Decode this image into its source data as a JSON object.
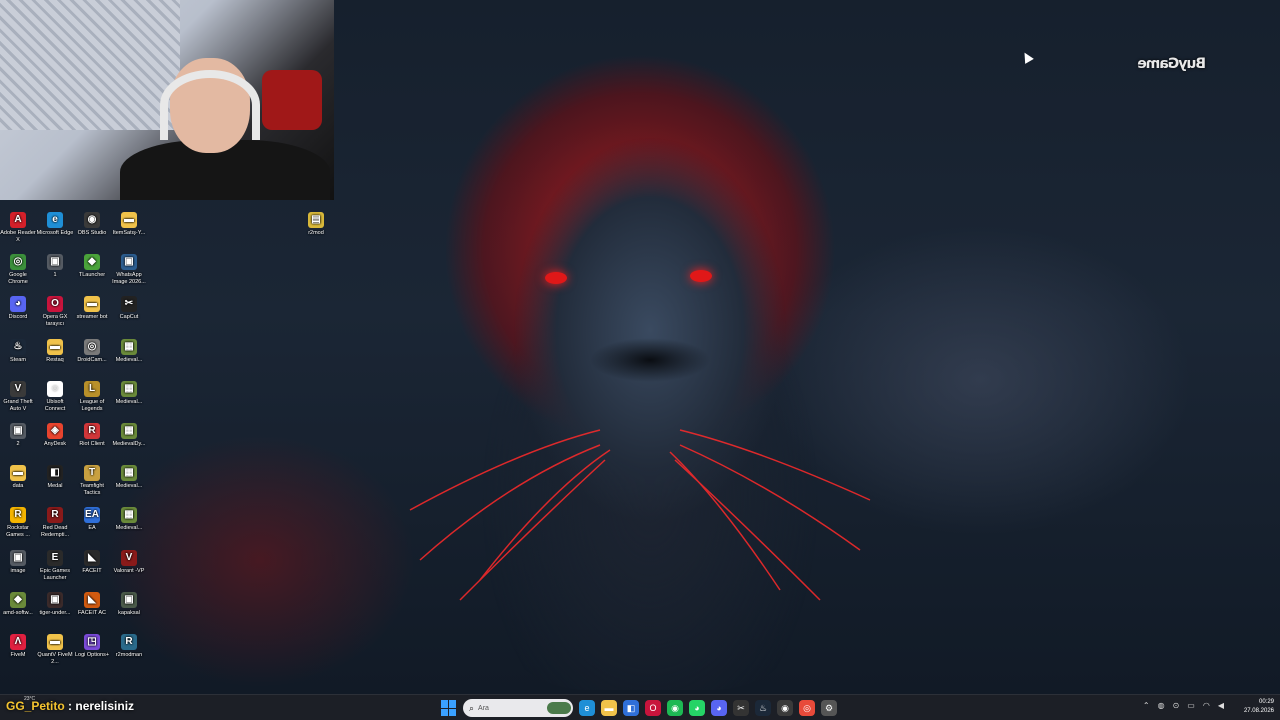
{
  "desktop": {
    "icons": [
      {
        "label": "Adobe Reader X",
        "icon": "adobe-reader-icon",
        "color": "#d4202a",
        "glyph": "A"
      },
      {
        "label": "Microsoft Edge",
        "icon": "edge-icon",
        "color": "#1f8fd6",
        "glyph": "e"
      },
      {
        "label": "OBS Studio",
        "icon": "obs-icon",
        "color": "#3a3a3a",
        "glyph": "◉"
      },
      {
        "label": "ItemSatış-Y...",
        "icon": "folder-icon",
        "color": "#f0c24a",
        "glyph": "▬"
      },
      {
        "label": "Google Chrome",
        "icon": "chrome-icon",
        "color": "#3b8f3b",
        "glyph": "◎"
      },
      {
        "label": "1",
        "icon": "image-file-icon",
        "color": "#555b63",
        "glyph": "▣"
      },
      {
        "label": "TLauncher",
        "icon": "tlauncher-icon",
        "color": "#4aa33a",
        "glyph": "◆"
      },
      {
        "label": "WhatsApp Image 2026...",
        "icon": "image-file-icon",
        "color": "#2c5d8f",
        "glyph": "▣"
      },
      {
        "label": "Discord",
        "icon": "discord-icon",
        "color": "#5865f2",
        "glyph": "◕"
      },
      {
        "label": "Opera GX tarayıcı",
        "icon": "opera-gx-icon",
        "color": "#c8143c",
        "glyph": "O"
      },
      {
        "label": "streamer bot",
        "icon": "folder-icon",
        "color": "#f0c24a",
        "glyph": "▬"
      },
      {
        "label": "CapCut",
        "icon": "capcut-icon",
        "color": "#222",
        "glyph": "✂"
      },
      {
        "label": "Steam",
        "icon": "steam-icon",
        "color": "#1b2838",
        "glyph": "♨"
      },
      {
        "label": "Restaq",
        "icon": "folder-icon",
        "color": "#f0c24a",
        "glyph": "▬"
      },
      {
        "label": "DroidCam...",
        "icon": "droidcam-icon",
        "color": "#7a7a7a",
        "glyph": "◎"
      },
      {
        "label": "Medieval...",
        "icon": "medieval-game-icon",
        "color": "#6a8a3a",
        "glyph": "▦"
      },
      {
        "label": "Grand Theft Auto V",
        "icon": "gta-icon",
        "color": "#3a3a3a",
        "glyph": "V"
      },
      {
        "label": "Ubisoft Connect",
        "icon": "ubisoft-icon",
        "color": "#ffffff",
        "glyph": "◌"
      },
      {
        "label": "League of Legends",
        "icon": "lol-icon",
        "color": "#b8902a",
        "glyph": "L"
      },
      {
        "label": "Medieval...",
        "icon": "medieval-game-icon",
        "color": "#6a8a3a",
        "glyph": "▦"
      },
      {
        "label": "2",
        "icon": "image-file-icon",
        "color": "#555b63",
        "glyph": "▣"
      },
      {
        "label": "AnyDesk",
        "icon": "anydesk-icon",
        "color": "#e8442e",
        "glyph": "◈"
      },
      {
        "label": "Riot Client",
        "icon": "riot-icon",
        "color": "#d13639",
        "glyph": "R"
      },
      {
        "label": "MedievalDy...",
        "icon": "medieval-game-icon",
        "color": "#6a8a3a",
        "glyph": "▦"
      },
      {
        "label": "data",
        "icon": "folder-icon",
        "color": "#f0c24a",
        "glyph": "▬"
      },
      {
        "label": "Medal",
        "icon": "medal-icon",
        "color": "#222",
        "glyph": "◧"
      },
      {
        "label": "Teamfight Tactics",
        "icon": "tft-icon",
        "color": "#c8a040",
        "glyph": "T"
      },
      {
        "label": "Medieval...",
        "icon": "medieval-game-icon",
        "color": "#6a8a3a",
        "glyph": "▦"
      },
      {
        "label": "Rockstar Games ...",
        "icon": "rockstar-icon",
        "color": "#f4b400",
        "glyph": "R"
      },
      {
        "label": "Red Dead Redempti...",
        "icon": "rdr-icon",
        "color": "#8a1a1a",
        "glyph": "R"
      },
      {
        "label": "EA",
        "icon": "ea-icon",
        "color": "#2f6fd8",
        "glyph": "EA"
      },
      {
        "label": "Medieval...",
        "icon": "medieval-game-icon",
        "color": "#6a8a3a",
        "glyph": "▦"
      },
      {
        "label": "image",
        "icon": "image-file-icon",
        "color": "#555b63",
        "glyph": "▣"
      },
      {
        "label": "Epic Games Launcher",
        "icon": "epic-icon",
        "color": "#2a2a2a",
        "glyph": "E"
      },
      {
        "label": "FACEIT",
        "icon": "faceit-icon",
        "color": "#2a2a2a",
        "glyph": "◣"
      },
      {
        "label": "Valorant -VP",
        "icon": "valorant-icon",
        "color": "#8a1a1a",
        "glyph": "V"
      },
      {
        "label": "amd-softw...",
        "icon": "installer-icon",
        "color": "#6a8a3a",
        "glyph": "◆"
      },
      {
        "label": "tiger-under...",
        "icon": "image-file-icon",
        "color": "#3a2a2a",
        "glyph": "▣"
      },
      {
        "label": "FACEIT AC",
        "icon": "faceit-ac-icon",
        "color": "#d05a10",
        "glyph": "◣"
      },
      {
        "label": "kapaksal",
        "icon": "image-file-icon",
        "color": "#4a5a4a",
        "glyph": "▣"
      },
      {
        "label": "FiveM",
        "icon": "fivem-icon",
        "color": "#e02040",
        "glyph": "Λ"
      },
      {
        "label": "QuantV FiveM 2...",
        "icon": "folder-icon",
        "color": "#f0c24a",
        "glyph": "▬"
      },
      {
        "label": "Logi Options+",
        "icon": "logi-icon",
        "color": "#7a4ad8",
        "glyph": "◳"
      },
      {
        "label": "r2modman",
        "icon": "r2modman-icon",
        "color": "#2a6a8a",
        "glyph": "R"
      },
      {
        "label": "r2mod",
        "icon": "zip-file-icon",
        "color": "#d8b83a",
        "glyph": "▤"
      }
    ]
  },
  "overlay": {
    "brand_logo": "BuyGame",
    "chat_user": "GG_Petito",
    "chat_sep": " : ",
    "chat_message": "nerelisiniz",
    "temperature": "23°C"
  },
  "taskbar": {
    "search_placeholder": "Ara",
    "pinned_apps": [
      {
        "icon": "edge-icon",
        "color": "#1f8fd6",
        "glyph": "e"
      },
      {
        "icon": "file-explorer-icon",
        "color": "#f0c24a",
        "glyph": "▬"
      },
      {
        "icon": "store-icon",
        "color": "#2f6fd8",
        "glyph": "◧"
      },
      {
        "icon": "opera-gx-icon",
        "color": "#c8143c",
        "glyph": "O"
      },
      {
        "icon": "spotify-icon",
        "color": "#1db954",
        "glyph": "◉"
      },
      {
        "icon": "whatsapp-icon",
        "color": "#25d366",
        "glyph": "◕"
      },
      {
        "icon": "discord-icon",
        "color": "#5865f2",
        "glyph": "◕"
      },
      {
        "icon": "capcut-icon",
        "color": "#333",
        "glyph": "✂"
      },
      {
        "icon": "steam-icon",
        "color": "#1b2838",
        "glyph": "♨"
      },
      {
        "icon": "obs-icon",
        "color": "#3a3a3a",
        "glyph": "◉"
      },
      {
        "icon": "chrome-icon",
        "color": "#e84a3a",
        "glyph": "◎"
      },
      {
        "icon": "settings-icon",
        "color": "#555",
        "glyph": "⚙"
      }
    ],
    "time": "00:29",
    "date": "27.08.2026"
  }
}
